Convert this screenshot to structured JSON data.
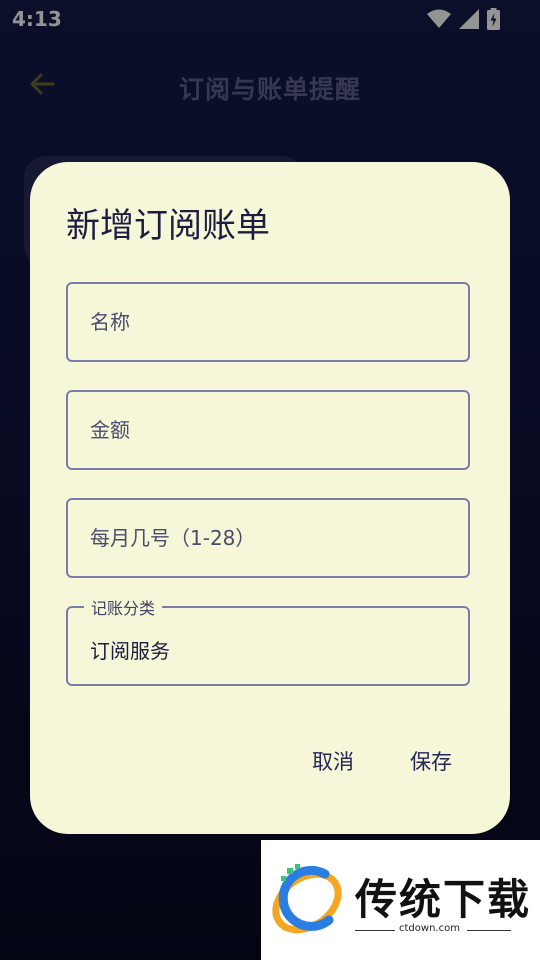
{
  "status_bar": {
    "time": "4:13",
    "icons": [
      "wifi-icon",
      "signal-icon",
      "battery-charging-icon"
    ]
  },
  "app_bar": {
    "title": "订阅与账单提醒",
    "back_icon": "arrow-left-icon",
    "accent": "#6b6a2a"
  },
  "dialog": {
    "title": "新增订阅账单",
    "fields": {
      "name": {
        "placeholder": "名称",
        "value": ""
      },
      "amount": {
        "placeholder": "金额",
        "value": ""
      },
      "day": {
        "placeholder": "每月几号（1-28）",
        "value": ""
      },
      "category": {
        "label": "记账分类",
        "value": "订阅服务"
      }
    },
    "buttons": {
      "cancel": "取消",
      "save": "保存"
    },
    "background": "#f6f6d9"
  },
  "watermark": {
    "brand": "传统下载",
    "url": "ctdown.com"
  }
}
